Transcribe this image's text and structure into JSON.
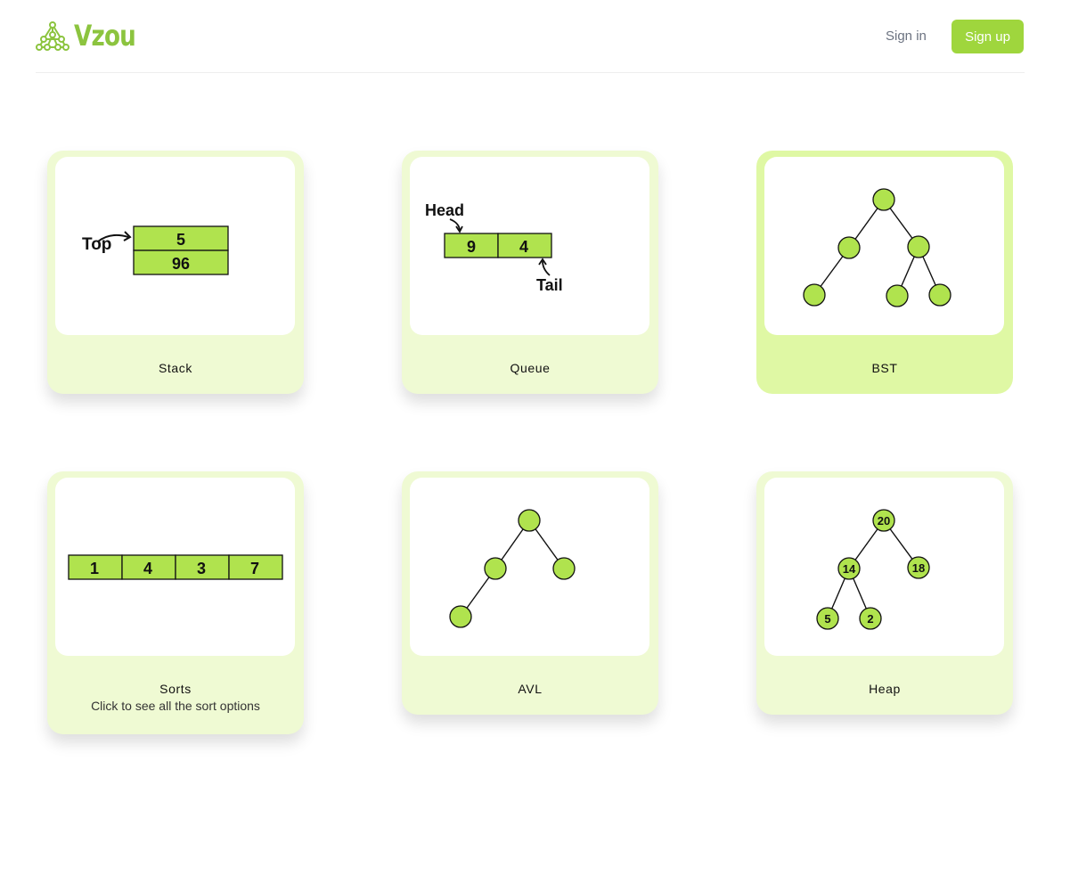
{
  "header": {
    "logo_text": "Vzou",
    "signin_label": "Sign in",
    "signup_label": "Sign up"
  },
  "colors": {
    "accent": "#9fd63d",
    "node_fill": "#b0e34e",
    "card_bg": "#effad3",
    "card_bg_active": "#dff8a4"
  },
  "cards": [
    {
      "title": "Stack",
      "illustration": {
        "label": "Top",
        "values": [
          "5",
          "96"
        ]
      }
    },
    {
      "title": "Queue",
      "illustration": {
        "head_label": "Head",
        "tail_label": "Tail",
        "values": [
          "9",
          "4"
        ]
      }
    },
    {
      "title": "BST"
    },
    {
      "title": "Sorts",
      "subtitle": "Click to see all the sort options",
      "illustration": {
        "values": [
          "1",
          "4",
          "3",
          "7"
        ]
      }
    },
    {
      "title": "AVL"
    },
    {
      "title": "Heap",
      "illustration": {
        "values": [
          "20",
          "14",
          "18",
          "5",
          "2"
        ]
      }
    }
  ]
}
